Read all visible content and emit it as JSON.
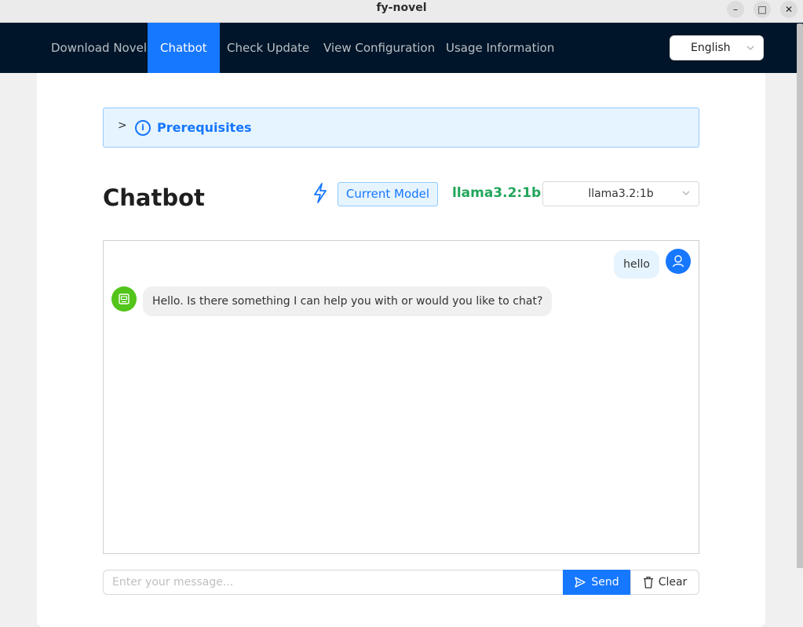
{
  "window": {
    "title": "fy-novel",
    "minimize_glyph": "–",
    "maximize_glyph": "□",
    "close_glyph": "✕"
  },
  "nav": {
    "items": [
      {
        "label": "Download Novel"
      },
      {
        "label": "Chatbot",
        "active": true
      },
      {
        "label": "Check Update"
      },
      {
        "label": "View Configuration"
      },
      {
        "label": "Usage Information"
      }
    ],
    "language": "English"
  },
  "prerequisites": {
    "arrow": ">",
    "icon_glyph": "i",
    "label": "Prerequisites"
  },
  "chatbot": {
    "title": "Chatbot",
    "current_model_label": "Current Model",
    "model_name": "llama3.2:1b",
    "model_select_value": "llama3.2:1b"
  },
  "messages": {
    "user": "hello",
    "bot": "Hello. Is there something I can help you with or would you like to chat?"
  },
  "composer": {
    "placeholder": "Enter your message...",
    "send_label": "Send",
    "clear_label": "Clear"
  },
  "colors": {
    "nav_bg": "#001529",
    "accent": "#1677ff",
    "model_green": "#21a65b",
    "bot_avatar": "#52c41a"
  },
  "icons": {
    "bolt": "lightning-icon",
    "user": "user-icon",
    "bot": "robot-icon",
    "send": "send-icon",
    "clear": "trash-icon"
  }
}
